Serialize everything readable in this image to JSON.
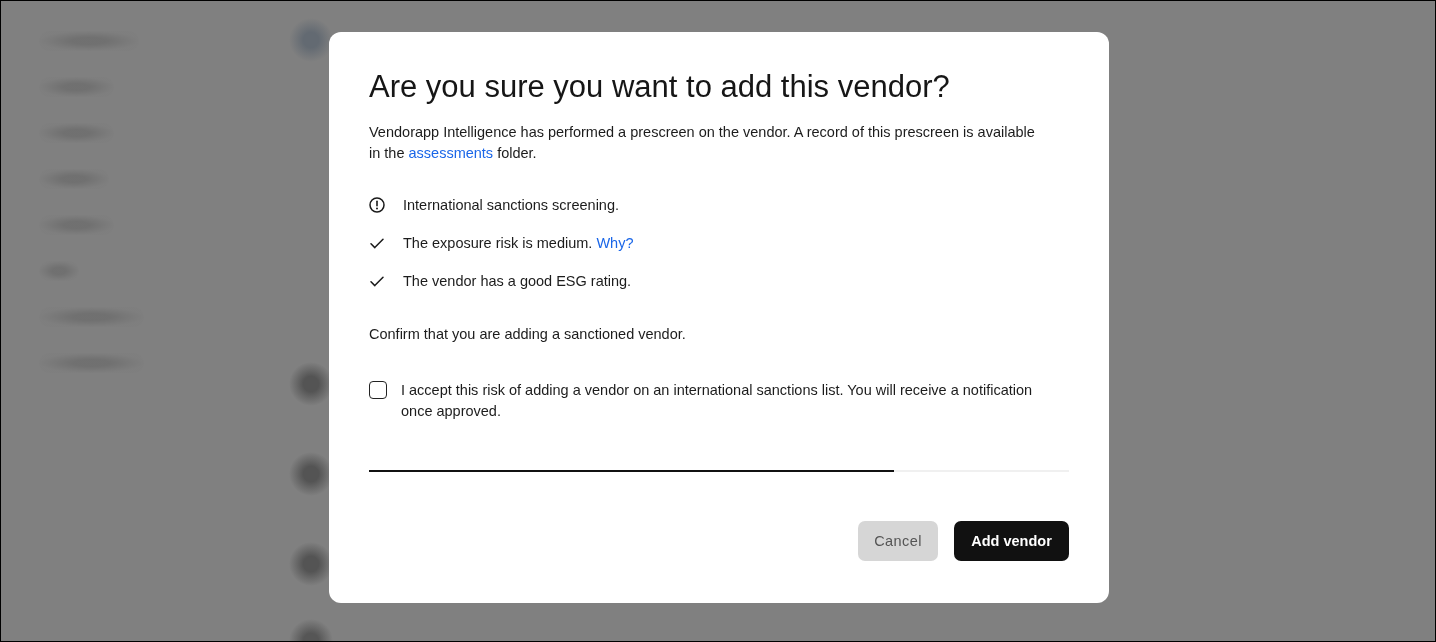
{
  "dialog": {
    "title": "Are you sure you want to add this vendor?",
    "intro": {
      "before": "Vendorapp Intelligence has performed a prescreen on the vendor. A record of this prescreen is available in the ",
      "link": "assessments",
      "after": " folder."
    },
    "checks": [
      {
        "kind": "alert",
        "text": "International sanctions screening."
      },
      {
        "kind": "check",
        "text": "The exposure risk is medium.",
        "link": "Why?"
      },
      {
        "kind": "check",
        "text": "The vendor has a good ESG rating."
      }
    ],
    "prompt": "Confirm that you are adding a sanctioned vendor.",
    "consent": {
      "checked": false,
      "label": "I accept this risk of adding a vendor on an international sanctions list. You will receive a notification once approved."
    },
    "progress": {
      "level": 0.75
    },
    "buttons": [
      {
        "kind": "secondary",
        "label": "Cancel"
      },
      {
        "kind": "primary",
        "label": "Add vendor"
      }
    ]
  }
}
